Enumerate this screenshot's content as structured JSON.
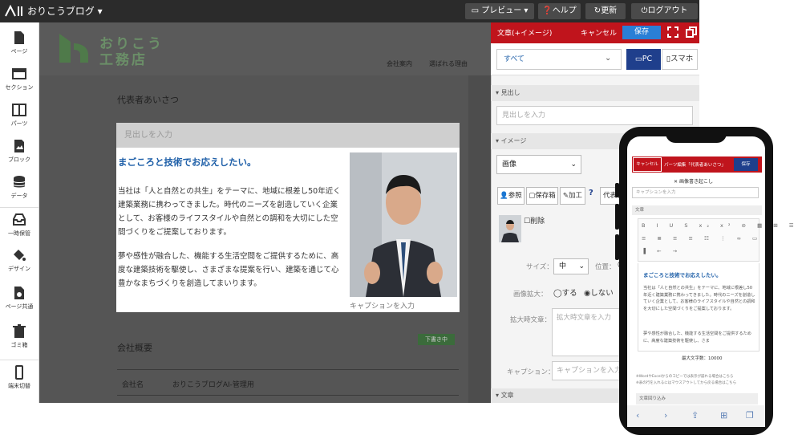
{
  "app": {
    "title": "おりこうブログ ▾"
  },
  "toolbar": {
    "preview": "プレビュー ▾",
    "help": "ヘルプ",
    "update": "更新",
    "logout": "ログアウト"
  },
  "sidebar": {
    "items": [
      {
        "label": "ページ",
        "icon": "page-icon"
      },
      {
        "label": "セクション",
        "icon": "section-icon"
      },
      {
        "label": "パーツ",
        "icon": "parts-icon"
      },
      {
        "label": "ブロック",
        "icon": "block-icon"
      },
      {
        "label": "データ",
        "icon": "data-icon"
      },
      {
        "label": "一時保管",
        "icon": "tray-icon"
      },
      {
        "label": "デザイン",
        "icon": "paint-bucket-icon"
      },
      {
        "label": "ページ共通",
        "icon": "page-common-icon"
      },
      {
        "label": "ゴミ箱",
        "icon": "trash-icon"
      },
      {
        "label": "端末切替",
        "icon": "smartphone-icon"
      }
    ]
  },
  "site": {
    "logo_line1": "おりこう",
    "logo_line2": "工務店",
    "nav": [
      "会社案内",
      "選ばれる理由"
    ],
    "greeting_heading": "代表者あいさつ",
    "company_heading": "会社概要",
    "edit_badge": "下書き中",
    "table": {
      "label": "会社名",
      "value": "おりこうブログAI-管理用"
    }
  },
  "block": {
    "heading_placeholder": "見出しを入力",
    "title": "まごころと技術でお応えしたい。",
    "paragraphs": [
      "当社は「人と自然との共生」をテーマに、地域に根差し50年近く建築業務に携わってきました。時代のニーズを創造していく企業として、お客様のライフスタイルや自然との調和を大切にした空間づくりをご提案しております。",
      "夢や感性が融合した、機能する生活空間をご提供するために、高度な建築技術を駆使し、さまざまな提案を行い、建築を通じて心豊かなまちづくりを創造してまいります。"
    ],
    "caption_placeholder": "キャプションを入力"
  },
  "panel": {
    "title": "文章(+イメージ)",
    "cancel": "キャンセル",
    "save": "保存",
    "device_select": "すべて",
    "pc": "PC",
    "smartphone": "スマホ",
    "sections": {
      "heading": "見出し",
      "image": "イメージ",
      "text": "文章"
    },
    "heading_placeholder": "見出しを入力",
    "image_type": "画像",
    "buttons": {
      "ref": "参照",
      "saved": "保存箱",
      "edit": "加工"
    },
    "alt_value": "代表者",
    "delete_label": "削除",
    "size_label": "サイズ：",
    "size_value": "中",
    "position_label": "位置：",
    "zoom_label": "画像拡大：",
    "zoom_yes": "する",
    "zoom_no": "しない",
    "zoom_text_label": "拡大時文章：",
    "zoom_text_placeholder": "拡大時文章を入力",
    "caption_label": "キャプション：",
    "caption_placeholder": "キャプションを入力"
  },
  "phone": {
    "cancel": "キャンセル",
    "title": "パーツ編集「代表者あいさつ」",
    "save": "保存",
    "ref": "画像書き起こし",
    "field": "キャプションを入力",
    "section": "文章",
    "body_title": "まごころと技術でお応えしたい。",
    "body_paras": [
      "当社は「人と自然との共生」をテーマに、地域に根差し50年近く建築業務に携わってきました。時代のニーズを創造していく企業として、お客様のライフスタイルや自然との調和を大切にした空間づくりをご提案しております。",
      "夢や感性が融合した、機能する生活空間をご提供するために、高度な建築技術を駆使し、さま"
    ],
    "count": "最大文字数：10000",
    "note1": "※WordやExcelからのコピーでは表示が崩れる場合はこちら",
    "note2": "※表の行を入れるにはマウスアウトしてから戻る場合はこちら",
    "field2": "文章回り込み"
  },
  "colors": {
    "accent_red": "#c0141c",
    "accent_blue": "#1f3f8c",
    "save_blue": "#2a7fd6",
    "title_blue": "#1e5fa8",
    "logo_green": "#6b8f68"
  }
}
